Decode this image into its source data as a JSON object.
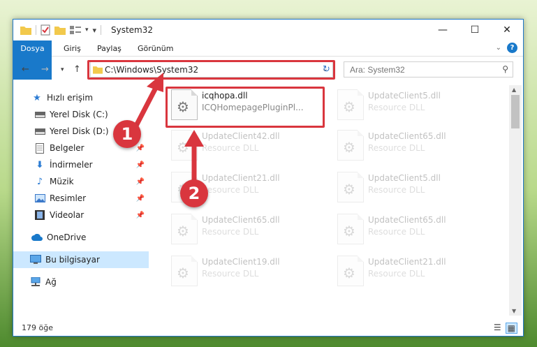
{
  "window": {
    "title": "System32"
  },
  "ribbon": {
    "tabs": [
      "Dosya",
      "Giriş",
      "Paylaş",
      "Görünüm"
    ]
  },
  "address": {
    "path": "C:\\Windows\\System32"
  },
  "search": {
    "placeholder": "Ara: System32"
  },
  "sidebar": {
    "items": [
      {
        "label": "Hızlı erişim",
        "icon": "star-icon"
      },
      {
        "label": "Yerel Disk (C:)",
        "icon": "drive-icon"
      },
      {
        "label": "Yerel Disk (D:)",
        "icon": "drive-icon"
      },
      {
        "label": "Belgeler",
        "icon": "document-icon"
      },
      {
        "label": "İndirmeler",
        "icon": "download-icon"
      },
      {
        "label": "Müzik",
        "icon": "music-icon"
      },
      {
        "label": "Resimler",
        "icon": "pictures-icon"
      },
      {
        "label": "Videolar",
        "icon": "video-icon"
      },
      {
        "label": "OneDrive",
        "icon": "cloud-icon"
      },
      {
        "label": "Bu bilgisayar",
        "icon": "computer-icon"
      },
      {
        "label": "Ağ",
        "icon": "network-icon"
      }
    ]
  },
  "files": [
    {
      "name": "icqhopa.dll",
      "desc": "ICQHomepagePluginPl..."
    },
    {
      "name": "UpdateClient5.dll",
      "desc": "Resource DLL"
    },
    {
      "name": "UpdateClient42.dll",
      "desc": "Resource DLL"
    },
    {
      "name": "UpdateClient65.dll",
      "desc": "Resource DLL"
    },
    {
      "name": "UpdateClient21.dll",
      "desc": "Resource DLL"
    },
    {
      "name": "UpdateClient5.dll",
      "desc": "Resource DLL"
    },
    {
      "name": "UpdateClient65.dll",
      "desc": "Resource DLL"
    },
    {
      "name": "UpdateClient65.dll",
      "desc": "Resource DLL"
    },
    {
      "name": "UpdateClient19.dll",
      "desc": "Resource DLL"
    },
    {
      "name": "UpdateClient21.dll",
      "desc": "Resource DLL"
    }
  ],
  "status": {
    "count": "179 öğe"
  },
  "annotations": {
    "step1": "1",
    "step2": "2",
    "color": "#d9363e"
  }
}
